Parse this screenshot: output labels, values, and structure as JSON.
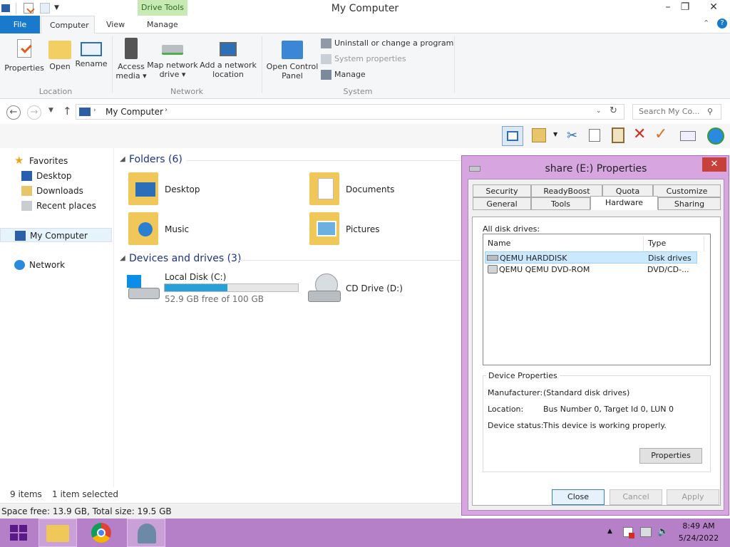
{
  "window": {
    "title": "My Computer",
    "context_tab": "Drive Tools",
    "controls": {
      "minimize": "–",
      "maximize": "❐",
      "close": "✕"
    }
  },
  "tabs": {
    "file": "File",
    "computer": "Computer",
    "view": "View",
    "manage": "Manage"
  },
  "ribbon": {
    "location": {
      "label": "Location",
      "properties": "Properties",
      "open": "Open",
      "rename": "Rename"
    },
    "network": {
      "label": "Network",
      "access_media_1": "Access",
      "access_media_2": "media",
      "map_drive_1": "Map network",
      "map_drive_2": "drive",
      "add_location_1": "Add a network",
      "add_location_2": "location"
    },
    "system": {
      "label": "System",
      "open_cp_1": "Open Control",
      "open_cp_2": "Panel",
      "uninstall": "Uninstall or change a program",
      "sys_props": "System properties",
      "manage": "Manage"
    }
  },
  "address": {
    "path": "My Computer",
    "search_placeholder": "Search My Co..."
  },
  "nav": {
    "favorites": "Favorites",
    "desktop": "Desktop",
    "downloads": "Downloads",
    "recent": "Recent places",
    "my_computer": "My Computer",
    "network": "Network"
  },
  "content": {
    "folders_header": "Folders (6)",
    "folders": [
      "Desktop",
      "Documents",
      "Music",
      "Pictures"
    ],
    "devices_header": "Devices and drives (3)",
    "local_disk": {
      "name": "Local Disk (C:)",
      "free": "52.9 GB free of 100 GB",
      "used_fraction": 0.471
    },
    "cd_drive": "CD Drive (D:)"
  },
  "status": {
    "items": "9 items",
    "selected": "1 item selected",
    "space": "Space free: 13.9 GB, Total size: 19.5 GB"
  },
  "dialog": {
    "title": "share (E:) Properties",
    "close": "✕",
    "tabs_row1": [
      "Security",
      "ReadyBoost",
      "Quota",
      "Customize"
    ],
    "tabs_row2": [
      "General",
      "Tools",
      "Hardware",
      "Sharing"
    ],
    "all_disk_drives": "All disk drives:",
    "col_name": "Name",
    "col_type": "Type",
    "rows": [
      {
        "name": "QEMU HARDDISK",
        "type": "Disk drives"
      },
      {
        "name": "QEMU QEMU DVD-ROM",
        "type": "DVD/CD-..."
      }
    ],
    "device_props": "Device Properties",
    "manufacturer_label": "Manufacturer:",
    "manufacturer": "(Standard disk drives)",
    "location_label": "Location:",
    "location": "Bus Number 0, Target Id 0, LUN 0",
    "status_label": "Device status:",
    "status": "This device is working properly.",
    "properties_btn": "Properties",
    "close_btn": "Close",
    "cancel_btn": "Cancel",
    "apply_btn": "Apply"
  },
  "taskbar": {
    "time": "8:49 AM",
    "date": "5/24/2022"
  }
}
